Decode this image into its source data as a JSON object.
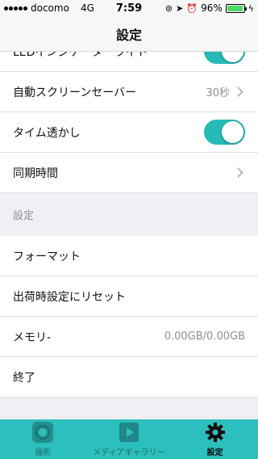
{
  "status_bar": {
    "carrier": "docomo",
    "network": "4G",
    "time": "7:59",
    "battery": "96%",
    "battery_level": 0.96
  },
  "nav": {
    "title": "設定"
  },
  "rows": {
    "led_partial": "LEDインジケーターライト",
    "screensaver_label": "自動スクリーンセーバー",
    "screensaver_value": "30秒",
    "watermark_label": "タイム透かし",
    "sync_label": "同期時間",
    "section_header": "設定",
    "format_label": "フォーマット",
    "reset_label": "出荷時設定にリセット",
    "memory_label": "メモリ-",
    "memory_value": "0.00GB/0.00GB",
    "exit_label": "終了"
  },
  "tabs": [
    {
      "label": "撮影",
      "icon": "camera-icon"
    },
    {
      "label": "メディアギャラリー",
      "icon": "play-icon"
    },
    {
      "label": "設定",
      "icon": "gear-icon"
    }
  ],
  "colors": {
    "accent": "#2bbfbd",
    "toggle_on": "#26b9b6"
  }
}
